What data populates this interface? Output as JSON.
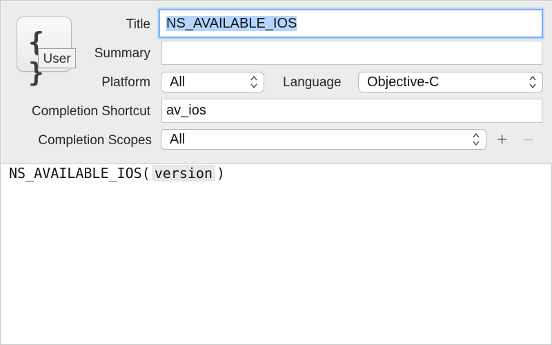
{
  "icon": {
    "symbol": "{ }",
    "name": "code-braces-icon",
    "badge": "User"
  },
  "labels": {
    "title": "Title",
    "summary": "Summary",
    "platform": "Platform",
    "language": "Language",
    "completion_shortcut": "Completion Shortcut",
    "completion_scopes": "Completion Scopes"
  },
  "fields": {
    "title_value": "NS_AVAILABLE_IOS",
    "summary_value": "",
    "platform_value": "All",
    "language_value": "Objective-C",
    "shortcut_value": "av_ios",
    "scopes_value": "All"
  },
  "buttons": {
    "add": "+",
    "remove": "−"
  },
  "code": {
    "prefix": "NS_AVAILABLE_IOS(",
    "token": "version",
    "suffix": ")"
  },
  "colors": {
    "selection": "#b4d5fe",
    "focus_ring": "#79aef2",
    "header_bg": "#ececec"
  }
}
